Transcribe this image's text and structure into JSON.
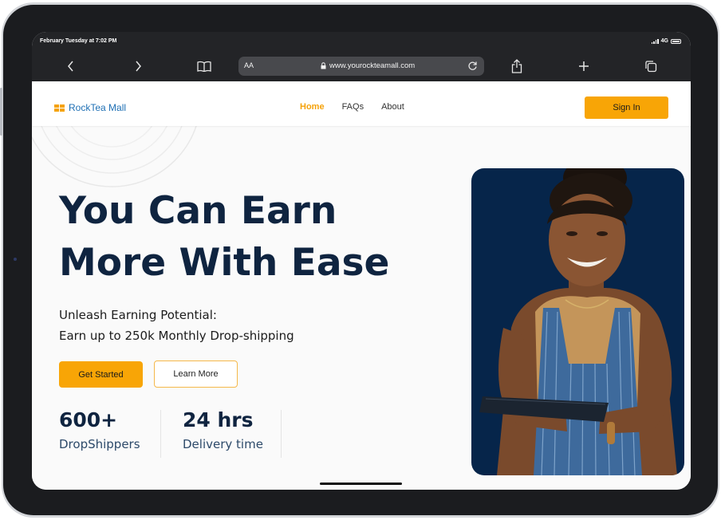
{
  "status": {
    "datetime": "February Tuesday at 7:02 PM",
    "network": "4G"
  },
  "browser": {
    "text_size_label": "AA",
    "url": "www.yourockteamall.com",
    "icons": [
      "back-icon",
      "forward-icon",
      "bookmarks-icon",
      "lock-icon",
      "reload-icon",
      "share-icon",
      "new-tab-icon",
      "tabs-icon"
    ]
  },
  "site": {
    "brand": "RockTea Mall",
    "brand_color": "#f5a20a",
    "nav": {
      "home": "Home",
      "faqs": "FAQs",
      "about": "About"
    },
    "signin": "Sign In",
    "hero": {
      "title_line1": "You Can Earn",
      "title_line2": "More With Ease",
      "subtitle_line1": "Unleash Earning Potential:",
      "subtitle_line2": "Earn up to 250k Monthly Drop-shipping",
      "cta_primary": "Get Started",
      "cta_secondary": "Learn More"
    },
    "stats": [
      {
        "value": "600+",
        "label": "DropShippers"
      },
      {
        "value": "24 hrs",
        "label": "Delivery time"
      }
    ],
    "colors": {
      "accent": "#f8a506",
      "heading": "#0f2440",
      "hero_card": "#06254a"
    }
  }
}
